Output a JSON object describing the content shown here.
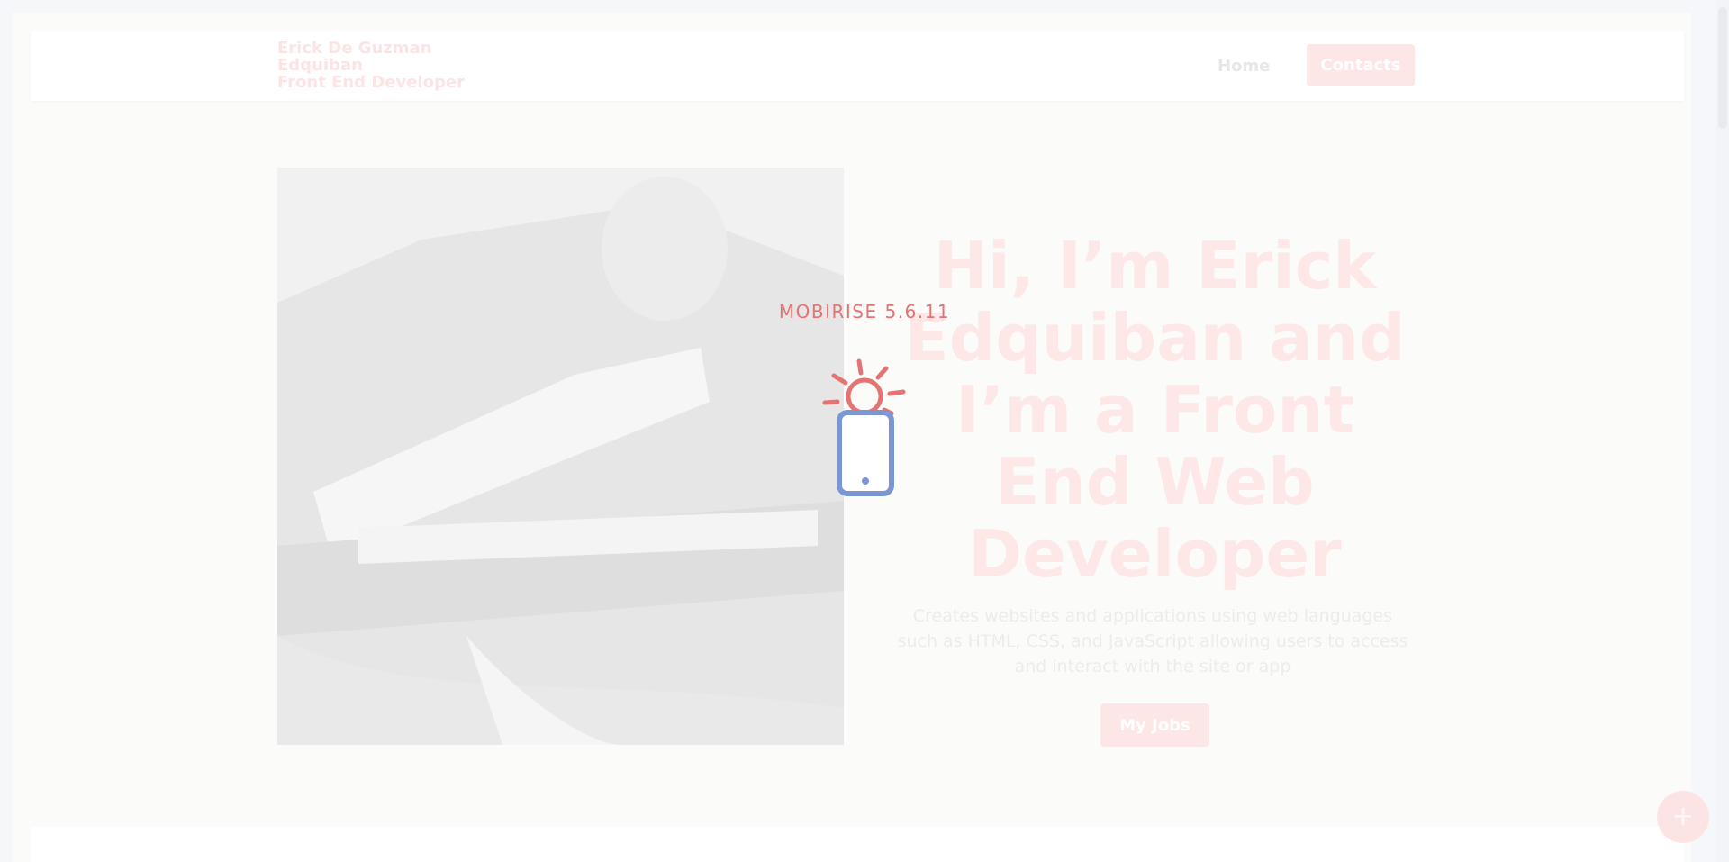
{
  "brand": {
    "line1": "Erick De Guzman",
    "line2": "Edquiban",
    "line3": "Front End Developer"
  },
  "nav": {
    "home": "Home",
    "contacts": "Contacts"
  },
  "hero": {
    "title": "Hi, I’m Erick Edquiban and I’m a Front End Web Developer",
    "description": "Creates websites and applications using web languages such as HTML, CSS, and JavaScript allowing users to access and interact with the site or app",
    "button": "My Jobs",
    "photo_alt": "photo"
  },
  "loader": {
    "label": "MOBIRISE  5.6.11",
    "icon": "phone-sun-icon"
  },
  "fab": {
    "icon": "plus-icon",
    "symbol": "+"
  },
  "colors": {
    "accent": "#e57373",
    "accent_faded": "#fde6e6",
    "phone_blue": "#7b96d4"
  }
}
